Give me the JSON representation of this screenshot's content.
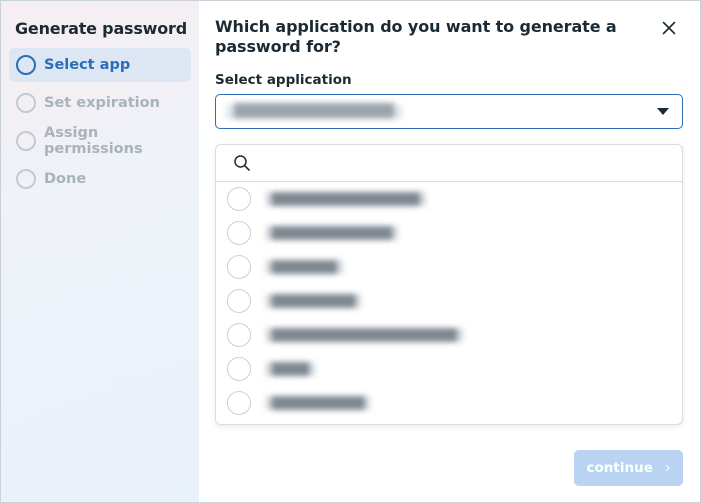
{
  "sidebar": {
    "title": "Generate password",
    "steps": [
      {
        "label": "Select app",
        "state": "active"
      },
      {
        "label": "Set expiration",
        "state": "inactive"
      },
      {
        "label": "Assign permissions",
        "state": "inactive"
      },
      {
        "label": "Done",
        "state": "inactive"
      }
    ]
  },
  "main": {
    "heading": "Which application do you want to generate a password for?",
    "close_icon": "close-icon",
    "select": {
      "label": "Select application",
      "value": "████████████████"
    },
    "dropdown": {
      "search_placeholder": "",
      "options": [
        {
          "label": "████████████████"
        },
        {
          "label": "█████████████"
        },
        {
          "label": "███████"
        },
        {
          "label": "█████████"
        },
        {
          "label": "████████████████████"
        },
        {
          "label": "████"
        },
        {
          "label": "██████████"
        }
      ]
    },
    "continue_label": "continue",
    "continue_icon": "chevron-right-icon"
  },
  "colors": {
    "accent": "#2a6ebb",
    "active_step_bg": "#dce7f3",
    "disabled_button": "#b9d4f3"
  }
}
